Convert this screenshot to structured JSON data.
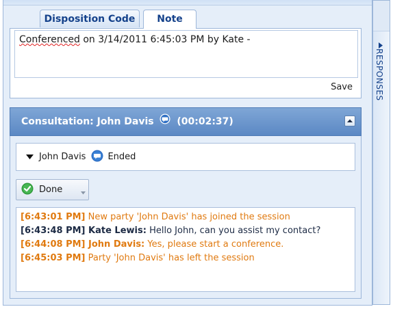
{
  "tabs": [
    {
      "label": "Disposition Code",
      "active": false
    },
    {
      "label": "Note",
      "active": true
    }
  ],
  "note": {
    "text_word_1": "Conferenced",
    "text_rest": " on 3/14/2011 6:45:03 PM by Kate -",
    "save_label": "Save"
  },
  "consultation": {
    "title_prefix": "Consultation: John Davis",
    "duration": "(00:02:37)",
    "party_name": "John Davis",
    "party_status": "Ended",
    "done_label": "Done"
  },
  "transcript": [
    {
      "time": "[6:43:01 PM]",
      "speaker": "",
      "text": " New party 'John Davis' has joined the session",
      "kind": "system"
    },
    {
      "time": "[6:43:48 PM]",
      "speaker": " Kate Lewis:",
      "text": " Hello John, can you assist my contact?",
      "kind": "agent"
    },
    {
      "time": "[6:44:08 PM]",
      "speaker": " John Davis:",
      "text": " Yes, please start a conference.",
      "kind": "party"
    },
    {
      "time": "[6:45:03 PM]",
      "speaker": "",
      "text": " Party 'John Davis' has left the session",
      "kind": "system"
    }
  ],
  "responses_label": "RESPONSES",
  "colors": {
    "header_blue": "#5b88c4",
    "system_orange": "#e07a10",
    "agent_text": "#1c2a44",
    "tab_text": "#15428b",
    "done_green": "#3aa845"
  }
}
